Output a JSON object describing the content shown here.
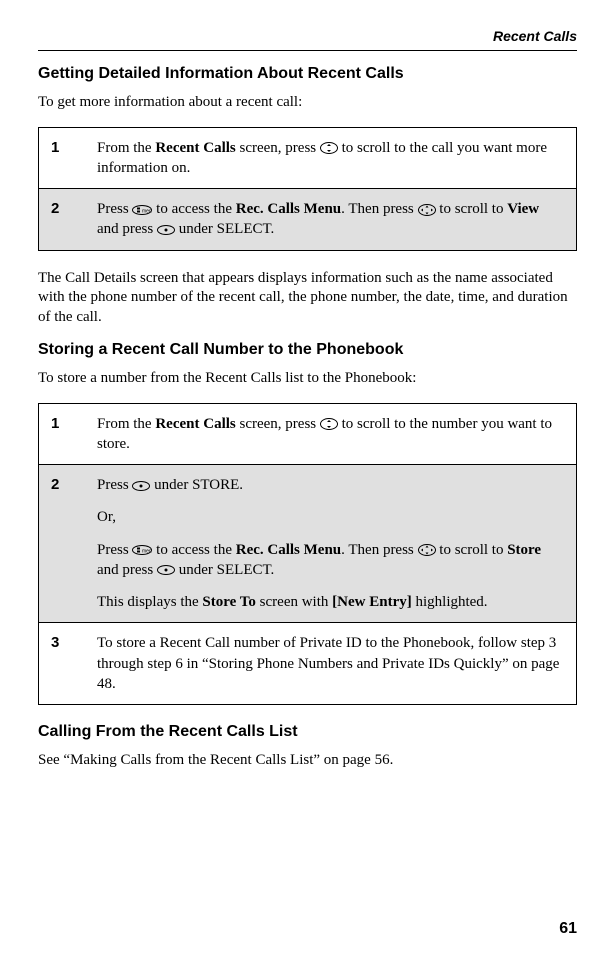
{
  "header": {
    "running_title": "Recent Calls"
  },
  "page_number": "61",
  "sections": {
    "s1": {
      "heading": "Getting Detailed Information About Recent Calls",
      "intro": "To get more information about a recent call:",
      "steps": [
        {
          "n": "1",
          "pre": "From the ",
          "bold1": "Recent Calls",
          "mid1": " screen, press ",
          "icon1": "scroll-icon",
          "post1": " to scroll to the call you want more information on."
        },
        {
          "n": "2",
          "pre": "Press ",
          "icon1": "menu-icon",
          "mid1": " to access the ",
          "bold1": "Rec. Calls Menu",
          "mid2": ". Then press ",
          "icon2": "nav-icon",
          "mid3": " to scroll to ",
          "bold2": "View",
          "mid4": " and press ",
          "icon3": "dot-icon",
          "post1": " under SELECT."
        }
      ],
      "after": "The Call Details screen that appears displays information such as the name associated with the phone number of the recent call, the phone number, the date, time, and duration of the call."
    },
    "s2": {
      "heading": "Storing a Recent Call Number to the Phonebook",
      "intro": "To store a number from the Recent Calls list to the Phonebook:",
      "steps": [
        {
          "n": "1",
          "pre": "From the ",
          "bold1": "Recent Calls",
          "mid1": " screen, press ",
          "icon1": "scroll-icon",
          "post1": " to scroll to the number you want to store."
        },
        {
          "n": "2",
          "p1_pre": "Press ",
          "p1_icon": "dot-icon",
          "p1_post": " under STORE.",
          "p2": "Or,",
          "p3_pre": "Press ",
          "p3_icon1": "menu-icon",
          "p3_mid1": " to access the ",
          "p3_bold1": "Rec. Calls Menu",
          "p3_mid2": ". Then press ",
          "p3_icon2": "nav-icon",
          "p3_mid3": " to scroll to ",
          "p3_bold2": "Store",
          "p3_mid4": " and press ",
          "p3_icon3": "dot-icon",
          "p3_post": " under SELECT.",
          "p4_pre": "This displays the ",
          "p4_bold1": "Store To",
          "p4_mid": " screen with ",
          "p4_bold2": "[New Entry]",
          "p4_post": " highlighted."
        },
        {
          "n": "3",
          "text": "To store a Recent Call number of Private ID to the Phonebook, follow step 3 through step 6 in “Storing Phone Numbers and Private IDs Quickly” on page 48."
        }
      ]
    },
    "s3": {
      "heading": "Calling From the Recent Calls List",
      "body": "See “Making Calls from the Recent Calls List” on page 56."
    }
  }
}
